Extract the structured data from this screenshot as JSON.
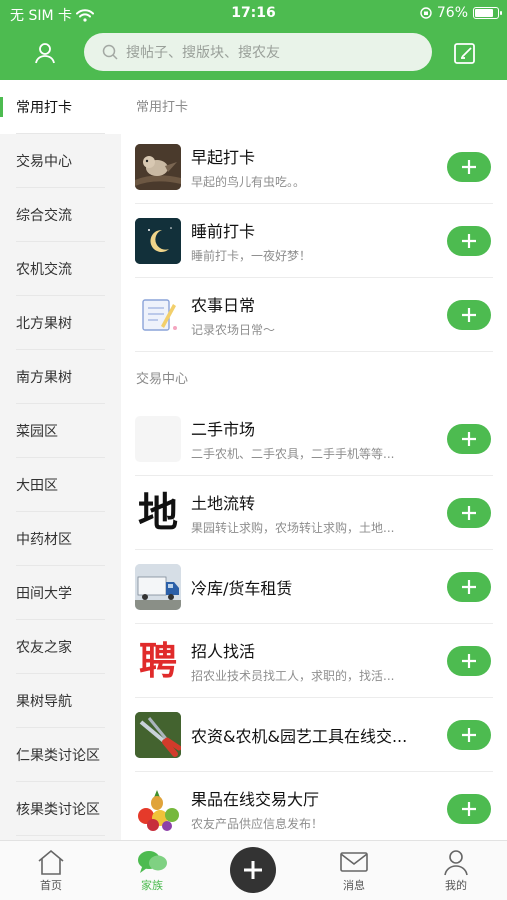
{
  "status_bar": {
    "carrier": "无 SIM 卡",
    "time": "17:16",
    "battery": "76%"
  },
  "header": {
    "search_placeholder": "搜帖子、搜版块、搜农友"
  },
  "sidebar": {
    "items": [
      {
        "label": "常用打卡",
        "active": true
      },
      {
        "label": "交易中心"
      },
      {
        "label": "综合交流"
      },
      {
        "label": "农机交流"
      },
      {
        "label": "北方果树"
      },
      {
        "label": "南方果树"
      },
      {
        "label": "菜园区"
      },
      {
        "label": "大田区"
      },
      {
        "label": "中药材区"
      },
      {
        "label": "田间大学"
      },
      {
        "label": "农友之家"
      },
      {
        "label": "果树导航"
      },
      {
        "label": "仁果类讨论区"
      },
      {
        "label": "核果类讨论区"
      }
    ]
  },
  "main": {
    "sections": [
      {
        "title": "常用打卡",
        "items": [
          {
            "name": "早起打卡",
            "desc": "早起的鸟儿有虫吃。。",
            "icon": "bird-thumb"
          },
          {
            "name": "睡前打卡",
            "desc": "睡前打卡，一夜好梦！",
            "icon": "moon-thumb"
          },
          {
            "name": "农事日常",
            "desc": "记录农场日常～",
            "icon": "notebook-thumb"
          }
        ]
      },
      {
        "title": "交易中心",
        "items": [
          {
            "name": "二手市场",
            "desc": "二手农机、二手农具，二手手机等等...",
            "icon": "blank-thumb"
          },
          {
            "name": "土地流转",
            "desc": "果园转让求购，农场转让求购，土地...",
            "icon": "land-character-thumb",
            "glyph": "地"
          },
          {
            "name": "冷库/货车租赁",
            "desc": "",
            "icon": "truck-thumb"
          },
          {
            "name": "招人找活",
            "desc": "招农业技术员找工人，求职的，找活...",
            "icon": "hire-character-thumb",
            "glyph": "聘"
          },
          {
            "name": "农资&农机&园艺工具在线交...",
            "desc": "",
            "icon": "shears-thumb"
          },
          {
            "name": "果品在线交易大厅",
            "desc": "农友产品供应信息发布！",
            "icon": "fruit-thumb"
          }
        ]
      }
    ]
  },
  "tabbar": {
    "tabs": [
      {
        "label": "首页",
        "icon": "home-icon"
      },
      {
        "label": "家族",
        "icon": "chat-bubbles-icon",
        "active": true
      },
      {
        "label": "消息",
        "icon": "mail-icon"
      },
      {
        "label": "我的",
        "icon": "user-icon"
      }
    ]
  },
  "colors": {
    "brand_green": "#4dbb50",
    "sidebar_bg": "#f4f4f4"
  }
}
